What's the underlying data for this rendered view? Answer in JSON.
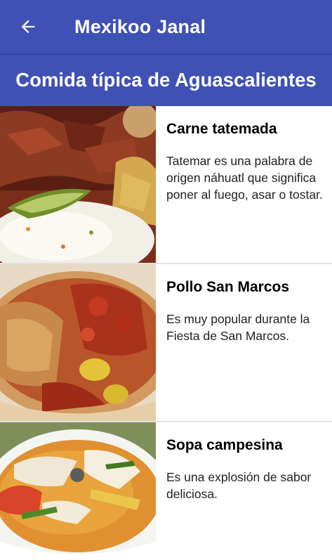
{
  "app_bar": {
    "title": "Mexikoo Janal",
    "back_icon": "arrow-back-icon"
  },
  "section": {
    "title": "Comida típica de Aguascalientes"
  },
  "dishes": [
    {
      "title": "Carne tatemada",
      "description": "Tatemar es una palabra de origen náhuatl que significa poner al fuego, asar o tostar."
    },
    {
      "title": "Pollo San Marcos",
      "description": "Es muy popular durante la Fiesta de San Marcos."
    },
    {
      "title": "Sopa campesina",
      "description": "Es una explosión de sabor deliciosa."
    }
  ],
  "colors": {
    "primary": "#3f51b5",
    "divider": "#e2e2e2"
  }
}
